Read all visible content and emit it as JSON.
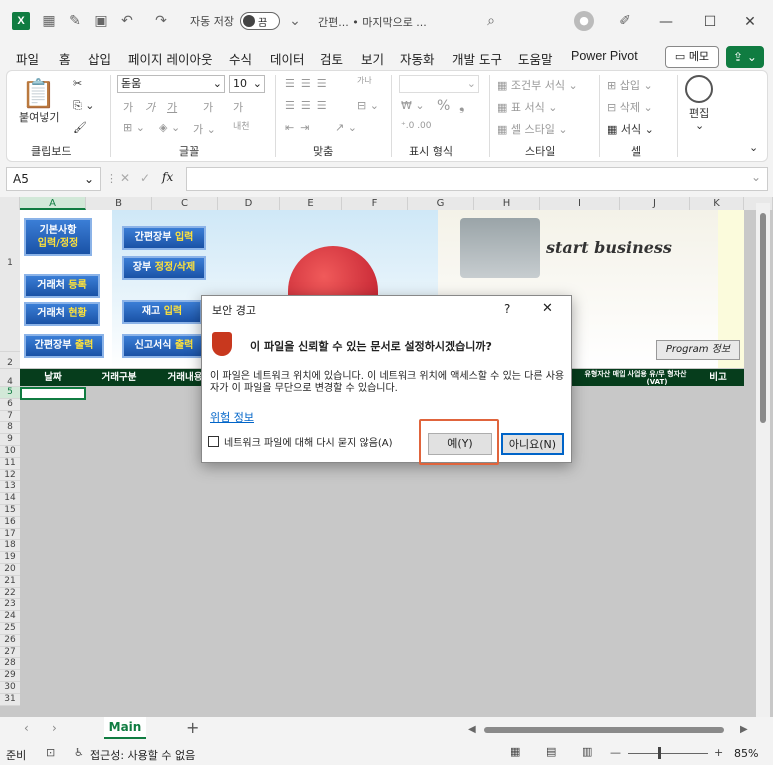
{
  "titlebar": {
    "app_logo": "X",
    "autosave_label": "자동 저장",
    "autosave_state": "끔",
    "doc_title": "간편... • 마지막으로 ...",
    "icons": [
      "grid-icon",
      "pin-icon",
      "save-icon",
      "undo-icon",
      "redo-icon",
      "qat-more-icon",
      "search-icon",
      "user-icon",
      "pen-icon",
      "minimize-icon",
      "maximize-icon",
      "close-icon"
    ]
  },
  "menu": {
    "items": [
      "파일",
      "홈",
      "삽입",
      "페이지 레이아웃",
      "수식",
      "데이터",
      "검토",
      "보기",
      "자동화",
      "개발 도구",
      "도움말",
      "Power Pivot"
    ],
    "active": "홈",
    "memo_label": "메모"
  },
  "ribbon": {
    "clipboard": {
      "paste_label": "붙여넣기",
      "group_label": "클립보드"
    },
    "font": {
      "font_name": "돋움",
      "font_size": "10",
      "group_label": "글꼴",
      "bold": "가",
      "italic": "가",
      "underline": "가",
      "grow": "가",
      "shrink": "가",
      "phonetic": "내천"
    },
    "align": {
      "group_label": "맞춤",
      "wrap": "가나"
    },
    "number": {
      "group_label": "표시 형식"
    },
    "styles": {
      "cond_format": "조건부 서식",
      "table_format": "표 서식",
      "cell_style": "셀 스타일",
      "group_label": "스타일"
    },
    "cells": {
      "insert": "삽입",
      "delete": "삭제",
      "format": "서식",
      "group_label": "셀"
    },
    "editing": {
      "label": "편집"
    }
  },
  "formula_bar": {
    "name_box": "A5",
    "fx": "fx",
    "content": ""
  },
  "columns": [
    "A",
    "B",
    "C",
    "D",
    "E",
    "F",
    "G",
    "H",
    "I",
    "J",
    "K"
  ],
  "rows": [
    "1",
    "2",
    "4",
    "5",
    "6",
    "7",
    "8",
    "9",
    "10",
    "11",
    "12",
    "13",
    "14",
    "15",
    "16",
    "17",
    "18",
    "19",
    "20",
    "21",
    "22",
    "23",
    "24",
    "25",
    "26",
    "27",
    "28",
    "29",
    "30",
    "31"
  ],
  "banner": {
    "buttons": [
      {
        "white": "기본사항",
        "yellow": "입력/정정"
      },
      {
        "white": "간편장부 ",
        "yellow": "입력"
      },
      {
        "white": "장부 ",
        "yellow": "정정/삭제"
      },
      {
        "white": "거래처 ",
        "yellow": "등록"
      },
      {
        "white": "거래처 ",
        "yellow": "현황"
      },
      {
        "white": "재고 ",
        "yellow": "입력"
      },
      {
        "white": "간편장부 ",
        "yellow": "출력"
      },
      {
        "white": "신고서식 ",
        "yellow": "출력"
      }
    ],
    "start_business": "start business",
    "program_info": "Program 정보"
  },
  "header_row": {
    "cells": [
      "날짜",
      "거래구분",
      "거래내용",
      "유형자산 매입",
      "사업용 유/무 형자산(VAT)",
      "비고"
    ]
  },
  "dialog": {
    "title": "보안 경고",
    "help": "?",
    "close": "✕",
    "question": "이 파일을 신뢰할 수 있는 문서로 설정하시겠습니까?",
    "body": "이 파일은 네트워크 위치에 있습니다. 이 네트워크 위치에 액세스할 수 있는 다른 사용자가 이 파일을 무단으로 변경할 수 있습니다.",
    "link": "위험 정보",
    "checkbox_label": "네트워크 파일에 대해 다시 묻지 않음(A)",
    "yes_label": "예(Y)",
    "no_label": "아니요(N)",
    "highlight_color": "#e0643c"
  },
  "sheet_tabs": {
    "active": "Main",
    "add": "+"
  },
  "status": {
    "ready": "준비",
    "accessibility": "접근성: 사용할 수 없음",
    "zoom": "85%",
    "zoom_minus": "—",
    "zoom_plus": "+"
  }
}
